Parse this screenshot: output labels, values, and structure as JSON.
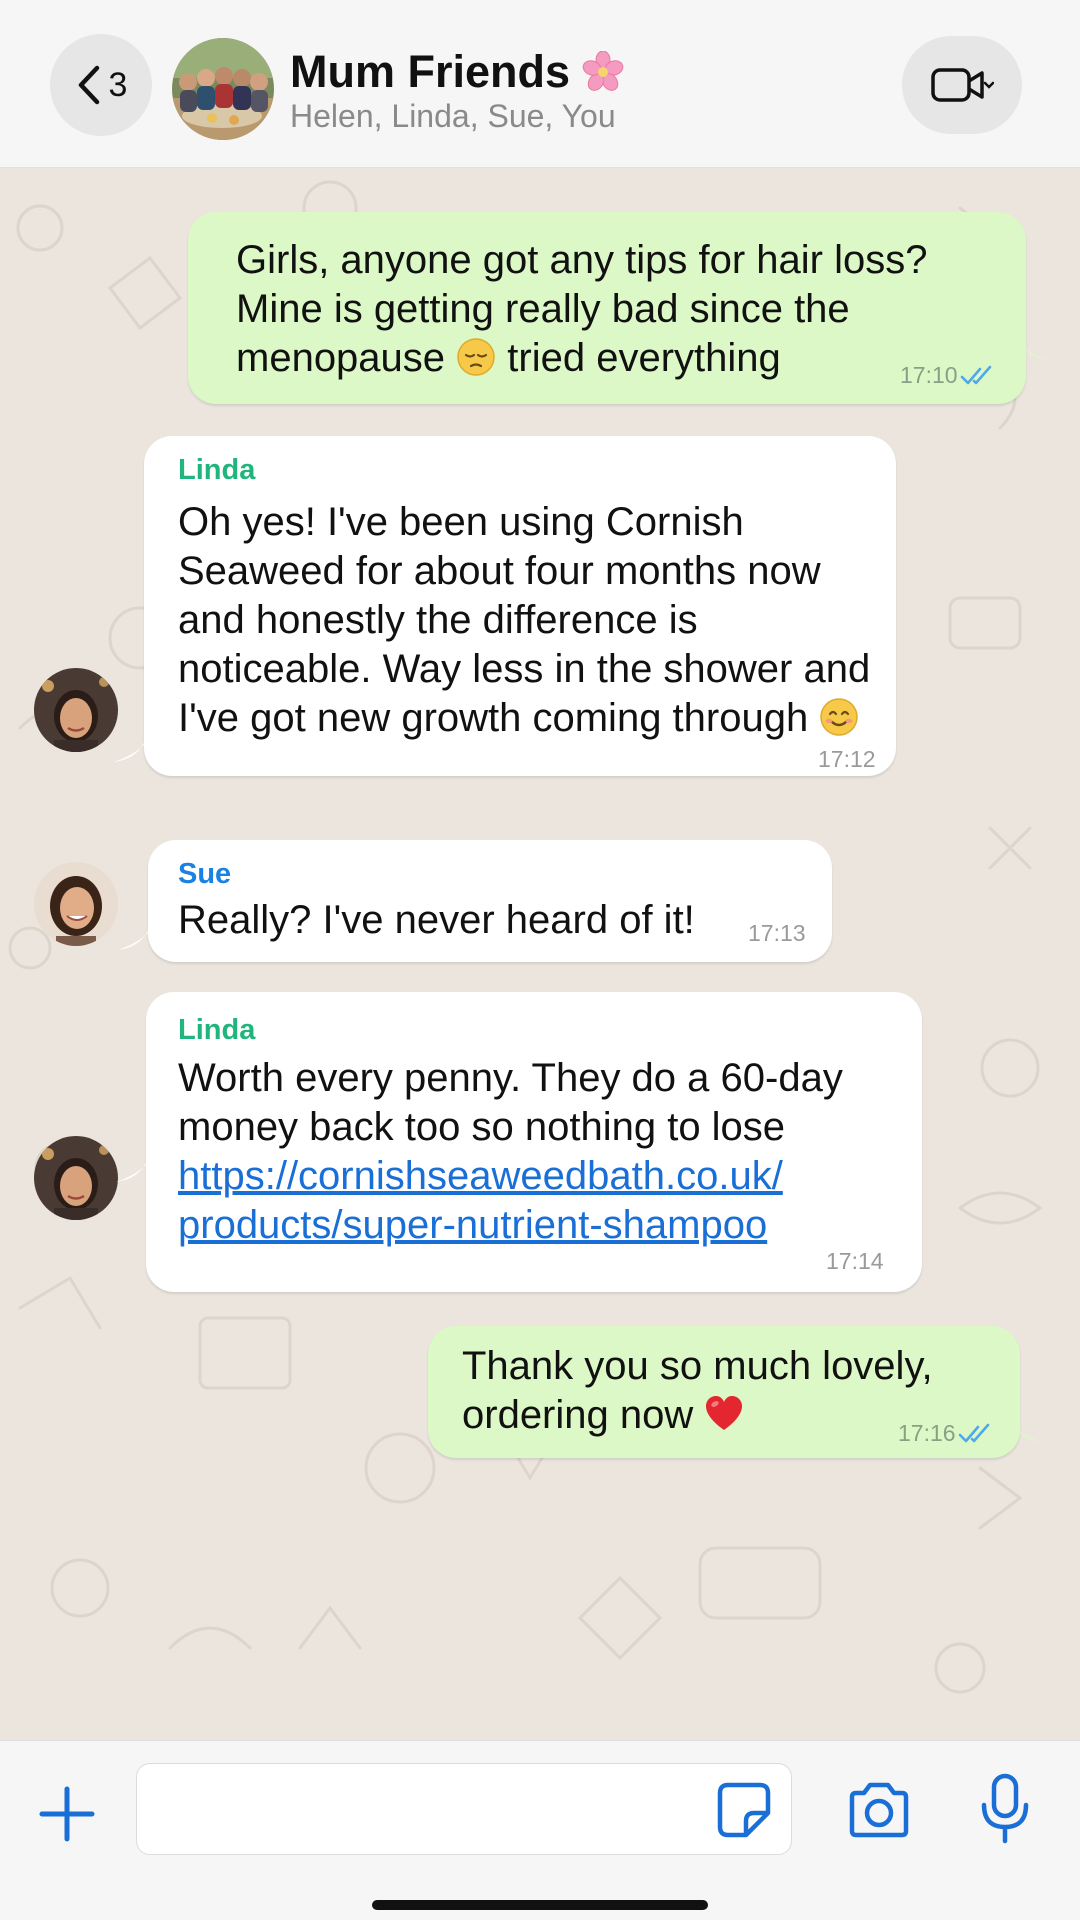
{
  "header": {
    "back_count": "3",
    "group_name": "Mum Friends",
    "group_emoji": "cherry-blossom",
    "participants": "Helen, Linda, Sue, You"
  },
  "messages": [
    {
      "direction": "outgoing",
      "text_part1": "Girls, anyone got any tips for hair loss? Mine is getting really bad since the menopause",
      "emoji": "pensive-face",
      "text_part2": "tried everything",
      "time": "17:10",
      "status": "read"
    },
    {
      "direction": "incoming",
      "sender": "Linda",
      "text_part1": "Oh yes! I've been using Cornish Seaweed for about four months now and honestly the difference is noticeable. Way less in the shower and I've got new growth coming through",
      "emoji": "smiling-face",
      "time": "17:12"
    },
    {
      "direction": "incoming",
      "sender": "Sue",
      "text": "Really? I've never heard of it!",
      "time": "17:13"
    },
    {
      "direction": "incoming",
      "sender": "Linda",
      "text": "Worth every penny. They do a 60-day money back too so nothing to lose",
      "link_line1": "https://cornishseaweedbath.co.uk/",
      "link_line2": "products/super-nutrient-shampoo",
      "time": "17:14"
    },
    {
      "direction": "outgoing",
      "text": "Thank you so much lovely, ordering now",
      "emoji": "red-heart",
      "time": "17:16",
      "status": "read"
    }
  ],
  "input": {
    "value": "",
    "placeholder": ""
  },
  "colors": {
    "outgoing_bubble": "#dcf8c6",
    "incoming_bubble": "#ffffff",
    "chat_background": "#ebe5de",
    "accent_blue": "#1a6fd6",
    "linda_name": "#1fb57c",
    "sue_name": "#1a82e2",
    "read_ticks": "#4fa8e8"
  },
  "icons": [
    "chevron-left-icon",
    "video-camera-icon",
    "plus-icon",
    "sticker-icon",
    "camera-icon",
    "microphone-icon",
    "double-check-icon"
  ]
}
